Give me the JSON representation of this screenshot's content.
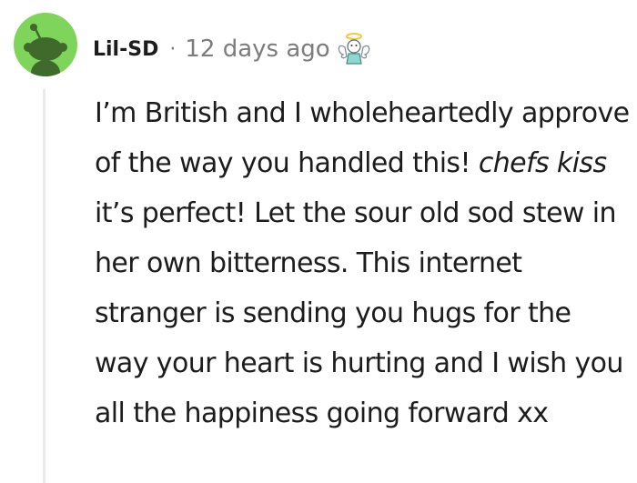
{
  "comment": {
    "username": "Lil-SD",
    "separator": "·",
    "timestamp": "12 days ago",
    "award_icon": "angel-award-icon",
    "avatar_icon": "reddit-snoo-avatar",
    "body": {
      "part1": "I’m British and I wholeheartedly approve of the way you handled this! ",
      "emphasis": "chefs kiss",
      "part2": " it’s perfect! Let the sour old sod stew in her own bitterness. This internet stranger is sending you hugs for the way your heart is hurting and I wish you all the happiness going forward xx"
    }
  },
  "colors": {
    "avatar_bg": "#7fd45c",
    "text": "#1c1c1c",
    "meta": "#7c7c7c",
    "thread_line": "#ebebeb"
  }
}
